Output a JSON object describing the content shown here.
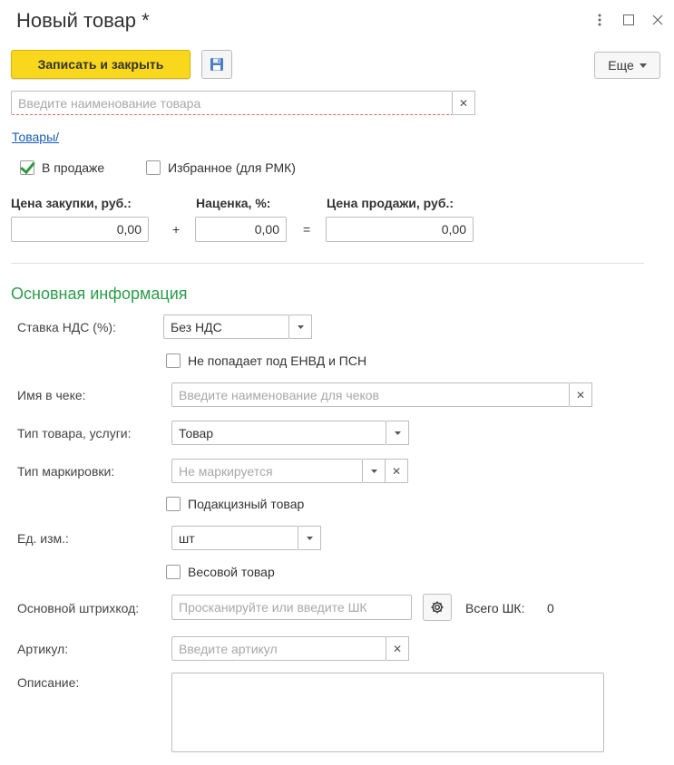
{
  "window": {
    "title": "Новый товар *"
  },
  "toolbar": {
    "write_close_label": "Записать и закрыть",
    "more_label": "Еще"
  },
  "name_field": {
    "placeholder": "Введите наименование товара"
  },
  "breadcrumb": {
    "link": "Товары/"
  },
  "flags": {
    "on_sale": {
      "label": "В продаже",
      "checked": true
    },
    "favorite": {
      "label": "Избранное (для РМК)",
      "checked": false
    }
  },
  "prices": {
    "purchase_label": "Цена закупки, руб.:",
    "purchase_value": "0,00",
    "markup_label": "Наценка, %:",
    "markup_value": "0,00",
    "sale_label": "Цена продажи, руб.:",
    "sale_value": "0,00",
    "plus": "+",
    "equals": "="
  },
  "main_info": {
    "section_title": "Основная информация",
    "vat_label": "Ставка НДС (%):",
    "vat_value": "Без НДС",
    "envd_label": "Не попадает под ЕНВД и ПСН",
    "receipt_name_label": "Имя в чеке:",
    "receipt_name_placeholder": "Введите наименование для чеков",
    "item_type_label": "Тип товара, услуги:",
    "item_type_value": "Товар",
    "marking_label": "Тип маркировки:",
    "marking_placeholder": "Не маркируется",
    "excise_label": "Подакцизный товар",
    "unit_label": "Ед. изм.:",
    "unit_value": "шт",
    "weight_label": "Весовой товар",
    "barcode_label": "Основной штрихкод:",
    "barcode_placeholder": "Просканируйте или введите ШК",
    "barcode_total_label": "Всего ШК:",
    "barcode_total_value": "0",
    "article_label": "Артикул:",
    "article_placeholder": "Введите артикул",
    "description_label": "Описание:"
  },
  "colors": {
    "primary_button": "#f9d71c",
    "section_title": "#2c9c4a",
    "link": "#1a5fb4",
    "checkmark": "#2e9b3b"
  }
}
